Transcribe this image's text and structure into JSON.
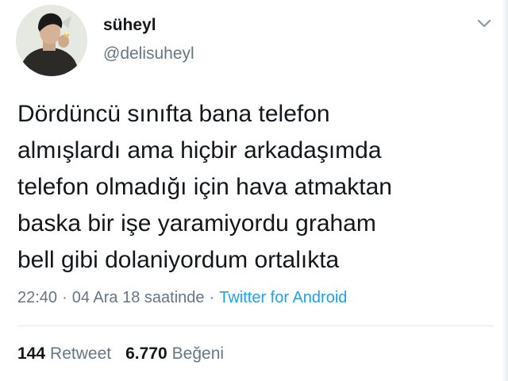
{
  "user": {
    "display_name": "süheyl",
    "handle": "@delisuheyl"
  },
  "icons": {
    "menu": "chevron-down-icon",
    "avatar": "avatar-photo"
  },
  "tweet": {
    "lines": [
      "Dördüncü sınıfta bana telefon",
      "almışlardı ama hiçbir arkadaşımda",
      "telefon olmadığı için hava atmaktan",
      "baska bir işe yaramiyordu graham",
      "bell gibi dolaniyordum ortalıkta"
    ],
    "time": "22:40",
    "date": "04 Ara 18 saatinde",
    "source": "Twitter for Android"
  },
  "stats": {
    "retweet_count": "144",
    "retweet_label": "Retweet",
    "like_count": "6.770",
    "like_label": "Beğeni"
  },
  "colors": {
    "text": "#14171a",
    "muted": "#657786",
    "link": "#1da1f2",
    "divider": "#e1e8ed"
  }
}
